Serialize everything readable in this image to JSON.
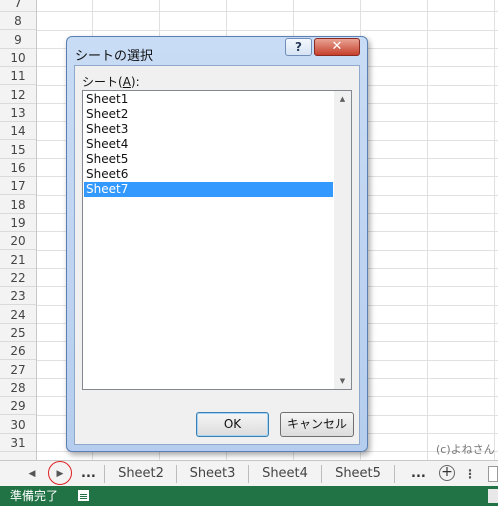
{
  "grid": {
    "rows": [
      "7",
      "8",
      "9",
      "10",
      "11",
      "12",
      "13",
      "14",
      "15",
      "16",
      "17",
      "18",
      "19",
      "20",
      "21",
      "22",
      "23",
      "24",
      "25",
      "26",
      "27",
      "28",
      "29",
      "30",
      "31"
    ]
  },
  "dialog": {
    "title": "シートの選択",
    "help_label": "?",
    "close_label": "✕",
    "list_label_prefix": "シート(",
    "list_label_key": "A",
    "list_label_suffix": "):",
    "sheets": [
      "Sheet1",
      "Sheet2",
      "Sheet3",
      "Sheet4",
      "Sheet5",
      "Sheet6",
      "Sheet7"
    ],
    "selected_sheet": "Sheet7",
    "ok_label": "OK",
    "cancel_label": "キャンセル",
    "scroll_up_icon": "▲",
    "scroll_down_icon": "▼"
  },
  "tabbar": {
    "prev_icon": "◀",
    "next_icon": "▶",
    "ellipsis_left": "...",
    "tabs": [
      "Sheet2",
      "Sheet3",
      "Sheet4",
      "Sheet5"
    ],
    "ellipsis_right": "...",
    "add_icon": "+"
  },
  "watermark": "(c)よねさん",
  "statusbar": {
    "status": "準備完了"
  },
  "colors": {
    "status_green": "#217346",
    "selection_blue": "#3399ff",
    "highlight_red": "#e02020"
  }
}
